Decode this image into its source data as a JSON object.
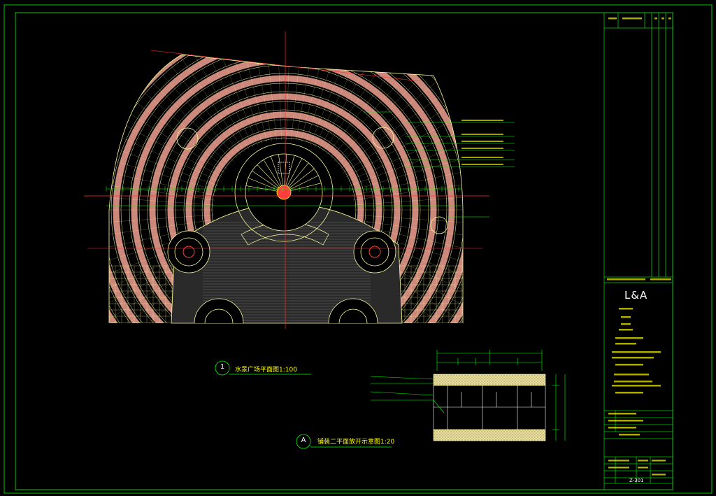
{
  "drawing": {
    "plan_title": "水景广场平面图1:100",
    "plan_number": "1",
    "detail_title": "铺装二平面放开示意图1:20",
    "detail_mark": "A"
  },
  "title_block": {
    "logo": "L&A",
    "drawing_no": "Z-301"
  }
}
